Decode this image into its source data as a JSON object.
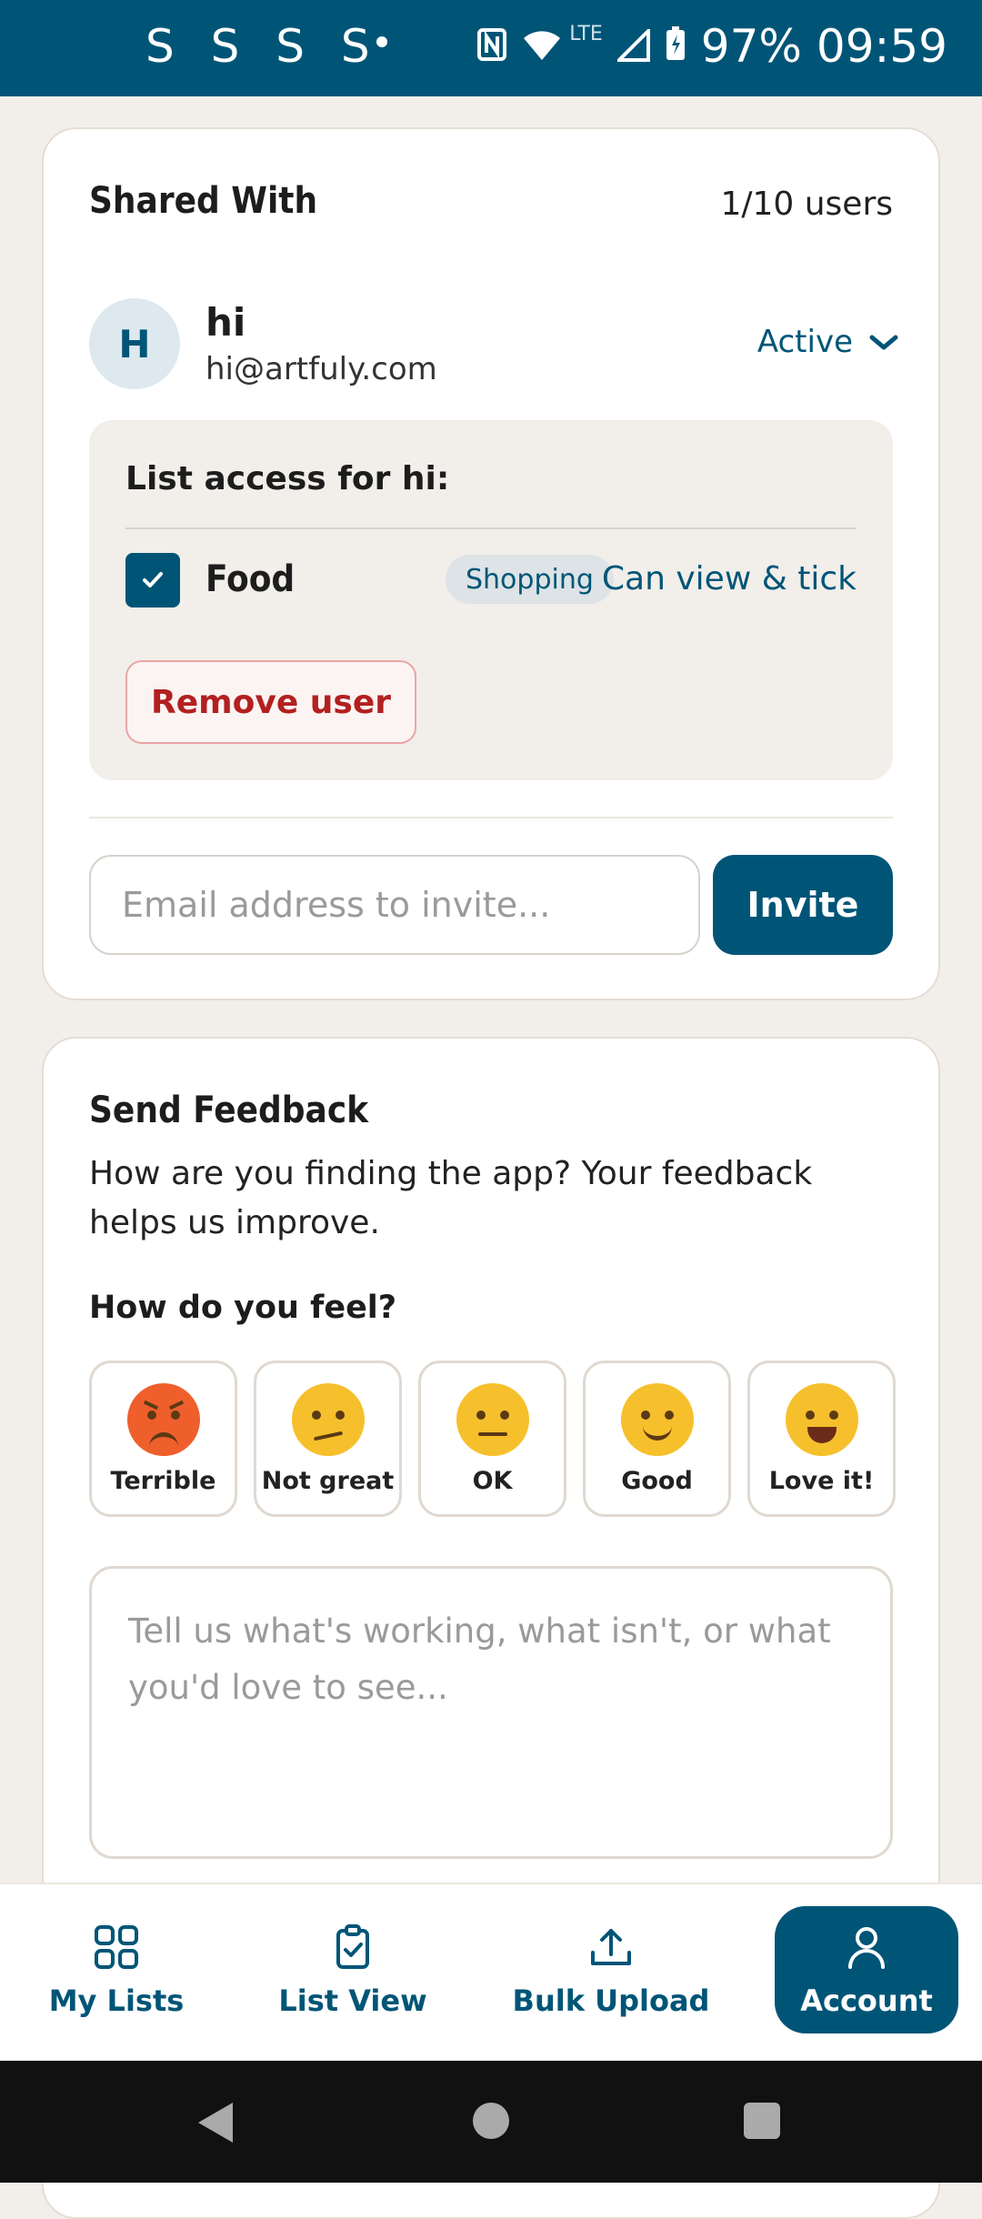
{
  "status_bar": {
    "left_icons": "S S S S",
    "battery": "97%",
    "time": "09:59",
    "network": "LTE"
  },
  "shared_with": {
    "title": "Shared With",
    "users_count": "1/10 users",
    "user": {
      "initial": "H",
      "name": "hi",
      "email": "hi@artfuly.com",
      "status": "Active"
    },
    "access": {
      "title": "List access for hi:",
      "list_name": "Food",
      "tag": "Shopping",
      "permission": "Can view & tick",
      "checked": true,
      "remove_label": "Remove user"
    },
    "invite": {
      "placeholder": "Email address to invite...",
      "button_label": "Invite"
    }
  },
  "feedback": {
    "title": "Send Feedback",
    "description": "How are you finding the app? Your feedback helps us improve.",
    "question": "How do you feel?",
    "moods": [
      {
        "label": "Terrible",
        "icon": "angry-face-icon"
      },
      {
        "label": "Not great",
        "icon": "confused-face-icon"
      },
      {
        "label": "OK",
        "icon": "neutral-face-icon"
      },
      {
        "label": "Good",
        "icon": "slight-smile-face-icon"
      },
      {
        "label": "Love it!",
        "icon": "grinning-face-icon"
      }
    ],
    "textarea_placeholder": "Tell us what's working, what isn't, or what you'd love to see..."
  },
  "nav": {
    "items": [
      {
        "label": "My Lists",
        "icon": "grid-icon"
      },
      {
        "label": "List View",
        "icon": "clipboard-check-icon"
      },
      {
        "label": "Bulk Upload",
        "icon": "upload-icon"
      },
      {
        "label": "Account",
        "icon": "user-icon",
        "active": true
      }
    ]
  },
  "colors": {
    "primary": "#005577",
    "background": "#f2eeea",
    "danger": "#b3201f"
  }
}
